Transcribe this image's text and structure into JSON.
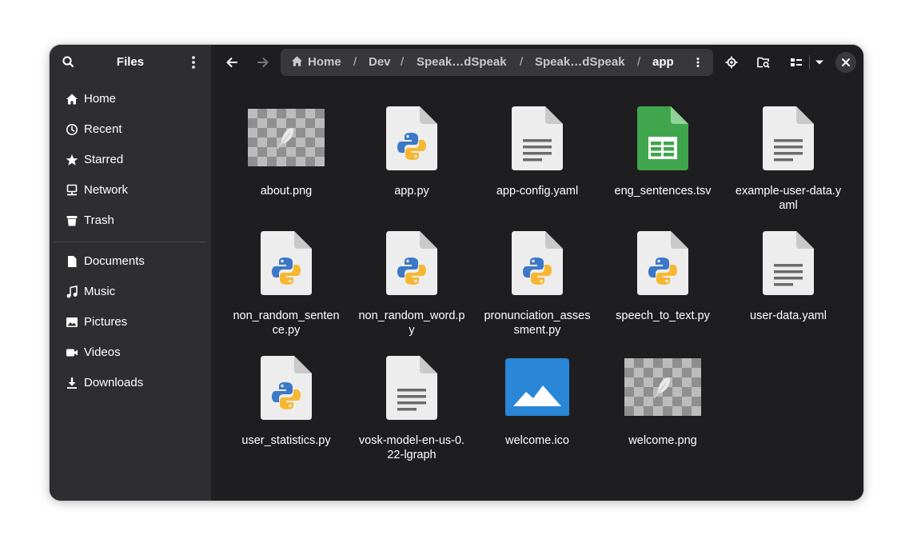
{
  "sidebar": {
    "title": "Files",
    "places": [
      {
        "label": "Home",
        "icon": "home-icon"
      },
      {
        "label": "Recent",
        "icon": "clock-icon"
      },
      {
        "label": "Starred",
        "icon": "star-icon"
      },
      {
        "label": "Network",
        "icon": "network-icon"
      },
      {
        "label": "Trash",
        "icon": "trash-icon"
      }
    ],
    "bookmarks": [
      {
        "label": "Documents",
        "icon": "document-icon"
      },
      {
        "label": "Music",
        "icon": "music-icon"
      },
      {
        "label": "Pictures",
        "icon": "picture-icon"
      },
      {
        "label": "Videos",
        "icon": "video-icon"
      },
      {
        "label": "Downloads",
        "icon": "download-icon"
      }
    ]
  },
  "pathbar": {
    "crumbs": [
      "Home",
      "Dev",
      "Speak…dSpeak",
      "Speak…dSpeak",
      "app"
    ],
    "separator": "/"
  },
  "files": [
    {
      "name": "about.png",
      "type": "image-thumbnail"
    },
    {
      "name": "app.py",
      "type": "python"
    },
    {
      "name": "app-config.yaml",
      "type": "text"
    },
    {
      "name": "eng_sentences.tsv",
      "type": "spreadsheet"
    },
    {
      "name": "example-user-data.yaml",
      "type": "text"
    },
    {
      "name": "non_random_sentence.py",
      "type": "python"
    },
    {
      "name": "non_random_word.py",
      "type": "python"
    },
    {
      "name": "pronunciation_assessment.py",
      "type": "python"
    },
    {
      "name": "speech_to_text.py",
      "type": "python"
    },
    {
      "name": "user-data.yaml",
      "type": "text"
    },
    {
      "name": "user_statistics.py",
      "type": "python"
    },
    {
      "name": "vosk-model-en-us-0.22-lgraph",
      "type": "text"
    },
    {
      "name": "welcome.ico",
      "type": "image"
    },
    {
      "name": "welcome.png",
      "type": "image-thumbnail"
    }
  ],
  "colors": {
    "sidebar_bg": "#2e2e32",
    "content_bg": "#1e1e20",
    "pathbar_bg": "#38383c",
    "spreadsheet_green": "#3fa64d",
    "image_blue": "#2a86d6",
    "python_blue": "#3b78c8",
    "python_yellow": "#f7b731"
  }
}
